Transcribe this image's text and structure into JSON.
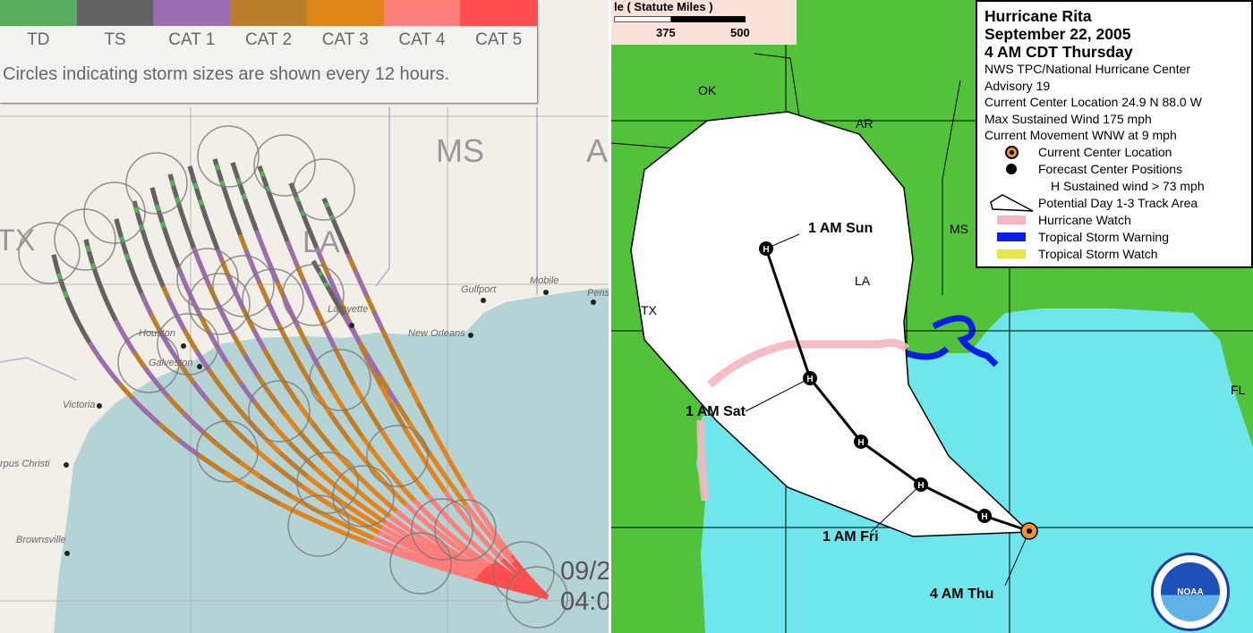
{
  "left_map": {
    "legend": {
      "categories": [
        {
          "label": "TD",
          "color": "#57ad5d"
        },
        {
          "label": "TS",
          "color": "#636363"
        },
        {
          "label": "CAT 1",
          "color": "#9a6db0"
        },
        {
          "label": "CAT 2",
          "color": "#bb7e2c"
        },
        {
          "label": "CAT 3",
          "color": "#e0851a"
        },
        {
          "label": "CAT 4",
          "color": "#ff7f7b"
        },
        {
          "label": "CAT 5",
          "color": "#ff4e4e"
        }
      ],
      "note": "Circles indicating storm sizes are shown every 12 hours."
    },
    "state_labels": [
      "TX",
      "MS",
      "LA",
      "A"
    ],
    "cities": [
      "Gulfport",
      "Mobile",
      "Pens",
      "Lafayette",
      "New Orleans",
      "Houston",
      "Galveston",
      "Victoria",
      "rpus Christi",
      "Brownsville"
    ],
    "time_label": [
      "09/2",
      "04:0"
    ],
    "colors": {
      "land": "#f2efe9",
      "water": "#b4d3d5"
    }
  },
  "right_map": {
    "scale": {
      "title": "le ( Statute Miles )",
      "ticks": [
        "375",
        "500"
      ]
    },
    "legend": {
      "title": [
        "Hurricane Rita",
        "September 22, 2005",
        "4 AM CDT Thursday"
      ],
      "lines": [
        "NWS TPC/National Hurricane Center",
        "Advisory 19",
        "Current Center Location 24.9 N  88.0 W",
        "Max Sustained Wind  175 mph",
        "Current Movement WNW at  9 mph"
      ],
      "items": [
        {
          "icon": "current-center-icon",
          "label": "Current Center Location"
        },
        {
          "icon": "forecast-position-icon",
          "label": "Forecast Center Positions"
        },
        {
          "icon": "",
          "label": "H  Sustained wind > 73 mph"
        },
        {
          "icon": "track-area-icon",
          "label": "Potential Day 1-3 Track Area"
        },
        {
          "icon": "swatch",
          "label": "Hurricane Watch",
          "color": "#f4b6bf"
        },
        {
          "icon": "swatch",
          "label": "Tropical Storm Warning",
          "color": "#0a1ee6"
        },
        {
          "icon": "swatch",
          "label": "Tropical Storm Watch",
          "color": "#e6e64a"
        }
      ]
    },
    "state_labels": [
      "OK",
      "AR",
      "MS",
      "LA",
      "TX",
      "FL"
    ],
    "forecast_labels": [
      "1 AM Sun",
      "1 AM Sat",
      "1 AM Fri",
      "4 AM Thu"
    ],
    "position_marker": "H",
    "logo": "NOAA",
    "colors": {
      "land": "#52c23a",
      "water": "#6ee6ec",
      "cone": "#ffffff"
    }
  }
}
